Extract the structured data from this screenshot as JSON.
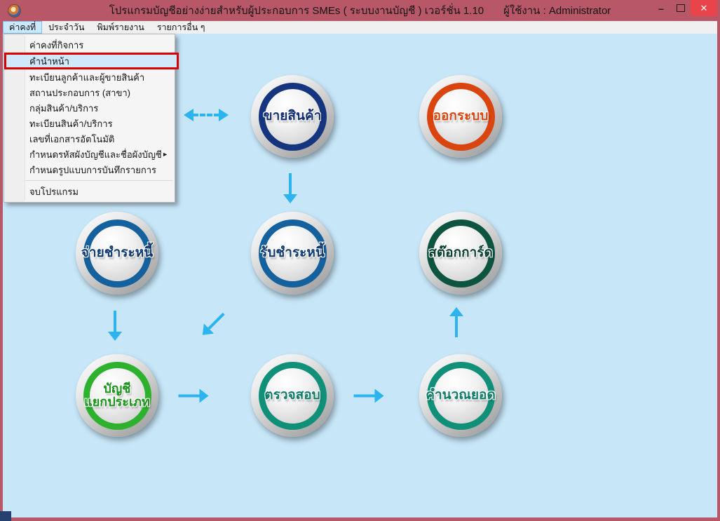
{
  "window": {
    "title_main": "โปรแกรมบัญชีอย่างง่ายสำหรับผู้ประกอบการ SMEs ( ระบบงานบัญชี )  เวอร์ชั่น 1.10",
    "title_user": "ผู้ใช้งาน : Administrator",
    "controls": {
      "minimize": "–",
      "close": "✕"
    }
  },
  "menu_bar": {
    "items": [
      {
        "label": "ค่าคงที่",
        "selected": true
      },
      {
        "label": "ประจำวัน",
        "selected": false
      },
      {
        "label": "พิมพ์รายงาน",
        "selected": false
      },
      {
        "label": "รายการอื่น ๆ",
        "selected": false
      }
    ]
  },
  "dropdown": {
    "submenu_glyph": "►",
    "items": [
      {
        "label": "ค่าคงที่กิจการ"
      },
      {
        "label": "คำนำหน้า",
        "highlighted": true
      },
      {
        "label": "ทะเบียนลูกค้าและผู้ขายสินค้า"
      },
      {
        "label": "สถานประกอบการ (สาขา)"
      },
      {
        "label": "กลุ่มสินค้า/บริการ"
      },
      {
        "label": "ทะเบียนสินค้า/บริการ"
      },
      {
        "label": "เลขที่เอกสารอัตโนมัติ"
      },
      {
        "label": "กำหนดรหัสผังบัญชีและชื่อผังบัญชี",
        "submenu": true
      },
      {
        "label": "กำหนดรูปแบบการบันทึกรายการ"
      },
      {
        "label": "จบโปรแกรม",
        "after_separator": true
      }
    ]
  },
  "buttons": [
    {
      "label": "ขายสินค้า",
      "ring": "#16357f",
      "text_color": "#122f73"
    },
    {
      "label": "ออกระบบ",
      "ring": "#d9440f",
      "text_color": "#d9440f"
    },
    {
      "label": "จ่ายชำระหนี้",
      "ring": "#15619e",
      "text_color": "#0f3a70"
    },
    {
      "label": "รับชำระหนี้",
      "ring": "#15619e",
      "text_color": "#0f3a70"
    },
    {
      "label": "สต๊อกการ์ด",
      "ring": "#0c5340",
      "text_color": "#093f30"
    },
    {
      "label": "บัญชีแยกประเภท",
      "line1": "บัญชี",
      "line2": "แยกประเภท",
      "ring": "#2eb22e",
      "text_color": "#189418"
    },
    {
      "label": "ตรวจสอบ",
      "ring": "#109078",
      "text_color": "#0b7b67"
    },
    {
      "label": "คำนวณยอด",
      "ring": "#109078",
      "text_color": "#0b7b67"
    }
  ],
  "flow_arrows": [
    {
      "name": "dashed-double-horizontal"
    },
    {
      "name": "down-from-sell"
    },
    {
      "name": "down-from-pay"
    },
    {
      "name": "down-left-from-receive"
    },
    {
      "name": "up-to-stock"
    },
    {
      "name": "right-ledger-to-check"
    },
    {
      "name": "right-check-to-calc"
    }
  ],
  "colors": {
    "titlebar": "#b75767",
    "close_button": "#e8444a",
    "content_bg": "#c7e6f8",
    "arrow": "#2bb4ef",
    "menu_highlight_border": "#d90000",
    "menu_highlight_bg": "#cfe8fa"
  }
}
